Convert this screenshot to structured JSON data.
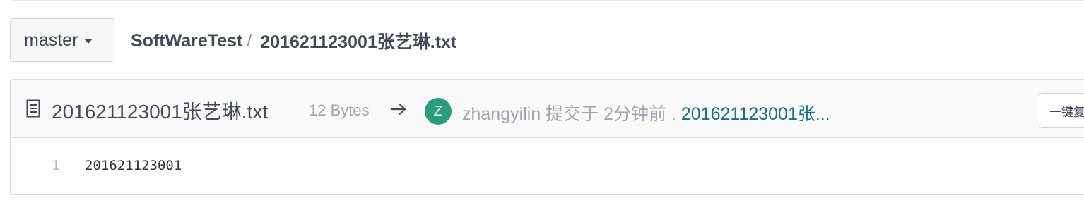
{
  "branch": {
    "label": "master"
  },
  "breadcrumb": {
    "repo": "SoftWareTest",
    "separator": "/",
    "file": "201621123001张艺琳.txt"
  },
  "file": {
    "icon": "file-text-icon",
    "name": "201621123001张艺琳.txt",
    "size": "12 Bytes",
    "arrow_icon": "arrow-right-icon"
  },
  "commit": {
    "avatar_letter": "Z",
    "avatar_color": "#2a9d7f",
    "author": "zhangyilin",
    "action": "提交于",
    "time": "2分钟前",
    "dot": ".",
    "message": "201621123001张..."
  },
  "toolbar": {
    "copy_label": "一键复制"
  },
  "code": {
    "lines": [
      {
        "number": "1",
        "text": "201621123001"
      }
    ]
  },
  "colors": {
    "link": "#1b6e87",
    "text": "#40485b",
    "muted": "#a0a4ae"
  }
}
